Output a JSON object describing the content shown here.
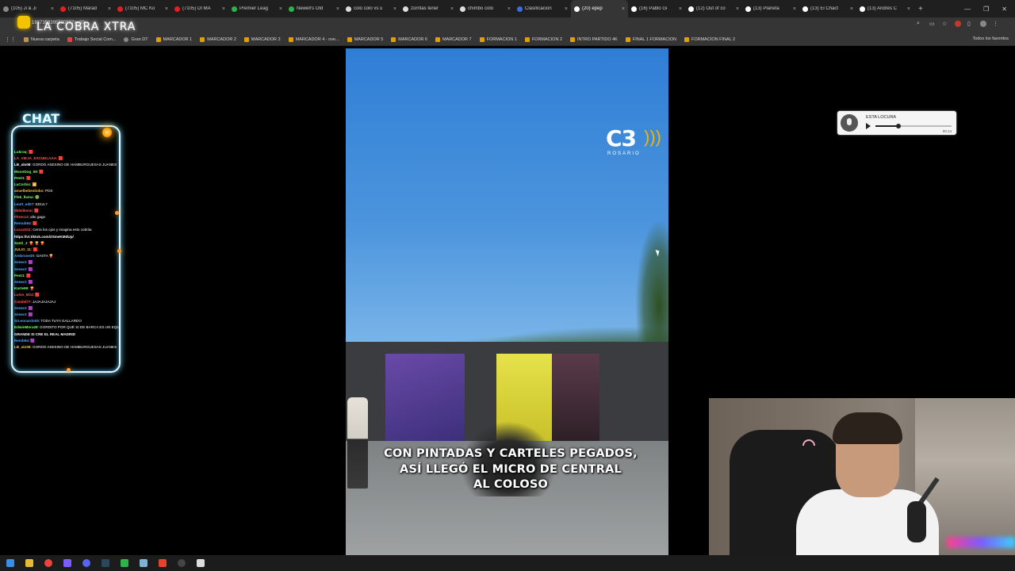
{
  "browser": {
    "tabs": [
      {
        "title": "(105) Ji & Ji",
        "color": "#888888",
        "active": false
      },
      {
        "title": "(7105) Marad",
        "color": "#e02020",
        "active": false
      },
      {
        "title": "(7105) MC Ko",
        "color": "#e02020",
        "active": false
      },
      {
        "title": "(7105) DI MA",
        "color": "#e02020",
        "active": false
      },
      {
        "title": "Premier Leag",
        "color": "#2db34a",
        "active": false
      },
      {
        "title": "Newell's Old",
        "color": "#2db34a",
        "active": false
      },
      {
        "title": "colo colo vs u",
        "color": "#dddddd",
        "active": false
      },
      {
        "title": "zorritas terier",
        "color": "#dddddd",
        "active": false
      },
      {
        "title": "chimbo colo",
        "color": "#dddddd",
        "active": false
      },
      {
        "title": "Clasificación",
        "color": "#3b6ee0",
        "active": false
      },
      {
        "title": "(20) epep",
        "color": "#ffffff",
        "active": true
      },
      {
        "title": "(16) Pablo Gi",
        "color": "#ffffff",
        "active": false
      },
      {
        "title": "(12) Out of co",
        "color": "#ffffff",
        "active": false
      },
      {
        "title": "(13) Planeta",
        "color": "#ffffff",
        "active": false
      },
      {
        "title": "(13) El Chact",
        "color": "#ffffff",
        "active": false
      },
      {
        "title": "(13) Andrés C",
        "color": "#ffffff",
        "active": false
      }
    ],
    "new_tab_glyph": "+",
    "close_glyph": "×",
    "window_controls": [
      "—",
      "❐",
      "✕"
    ],
    "url_fragment": "1937353395530507s=20",
    "bookmarks": [
      {
        "label": "Nueva carpeta",
        "kind": "folder"
      },
      {
        "label": "Trabajo Social Com...",
        "kind": "red"
      },
      {
        "label": "Gran DT",
        "kind": "gray"
      },
      {
        "label": "MARCADOR 1",
        "kind": "u"
      },
      {
        "label": "MARCADOR 2",
        "kind": "u"
      },
      {
        "label": "MARCADOR 3",
        "kind": "u"
      },
      {
        "label": "MARCADOR 4 - ove...",
        "kind": "u"
      },
      {
        "label": "MARCADOR 5",
        "kind": "u"
      },
      {
        "label": "MARCADOR 6",
        "kind": "u"
      },
      {
        "label": "MARCADOR 7",
        "kind": "u"
      },
      {
        "label": "FORMACION 1",
        "kind": "u"
      },
      {
        "label": "FORMACION 2",
        "kind": "u"
      },
      {
        "label": "INTRO PARTIDO 4K",
        "kind": "u"
      },
      {
        "label": "FINAL 1 FORMACION",
        "kind": "u"
      },
      {
        "label": "FORMACION FINAL 2",
        "kind": "u"
      }
    ],
    "all_bookmarks": "Todos los favoritos"
  },
  "overlay": {
    "brand_title": "LA COBRA XTRA",
    "chat_title": "CHAT"
  },
  "chat": [
    {
      "user": "Lukroq",
      "msg": ": 🟥",
      "color": "#7dff6b"
    },
    {
      "user": "LA_VIEJA_ESCUELAAA",
      "msg": ": 🟥",
      "color": "#ff5a5a"
    },
    {
      "user": "LB_alo08",
      "msg": ": GORDO ASESINO DE HAMBURGUESAS JUANES",
      "color": "#ffffff"
    },
    {
      "user": "MoonDog_59",
      "msg": ": 🟥",
      "color": "#7dff6b"
    },
    {
      "user": "Pent1",
      "msg": ": 🟥",
      "color": "#7dff6b"
    },
    {
      "user": "LaCorbix",
      "msg": ": 📶",
      "color": "#7dff6b"
    },
    {
      "user": "anuelbebestiobo",
      "msg": ": PDS",
      "color": "#f0c040"
    },
    {
      "user": "Flek_llama",
      "msg": ": 🟢",
      "color": "#7dff6b"
    },
    {
      "user": "Leutt_ed07",
      "msg": ": EDUL?",
      "color": "#54a9ff"
    },
    {
      "user": "0bb0ikeno",
      "msg": ": 🟥",
      "color": "#ff5a5a"
    },
    {
      "user": "Fhrec12",
      "msg": ": alto gago",
      "color": "#ff5a5a"
    },
    {
      "user": "Remub94",
      "msg": ": 🟥",
      "color": "#54a9ff"
    },
    {
      "user": "Lucas911",
      "msg": ": Cerra los ojos y imagina esto cobrita",
      "color": "#ff5a5a"
    },
    {
      "user": "https://vt.tiktok.com/ZSmeKMdUp/",
      "msg": "",
      "color": "#ffffff"
    },
    {
      "user": "Santi_J",
      "msg": ": 🍟 🍟 🍟",
      "color": "#7dff6b"
    },
    {
      "user": "JULIO_11",
      "msg": ": 🟥",
      "color": "#f0c040"
    },
    {
      "user": "Ambrose30",
      "msg": ": GASTA 🍟",
      "color": "#54a9ff"
    },
    {
      "user": "Xenect",
      "msg": ": 🟪",
      "color": "#54a9ff"
    },
    {
      "user": "Xenect",
      "msg": ": 🟪",
      "color": "#54a9ff"
    },
    {
      "user": "Pent1",
      "msg": ": 🟥",
      "color": "#7dff6b"
    },
    {
      "user": "Xenect",
      "msg": ": 🟪",
      "color": "#54a9ff"
    },
    {
      "user": "Korte99",
      "msg": ": 🍟",
      "color": "#7dff6b"
    },
    {
      "user": "Luisn_M14",
      "msg": ": 🟥",
      "color": "#ff5a5a"
    },
    {
      "user": "Candel77",
      "msg": ": JAJAJAJAJAJ",
      "color": "#ff5a5a"
    },
    {
      "user": "Xenect",
      "msg": ": 🟪",
      "color": "#54a9ff"
    },
    {
      "user": "Xenect",
      "msg": ": 🟪",
      "color": "#54a9ff"
    },
    {
      "user": "SrLeonardo05",
      "msg": ": TODA TUYA GALLARDO",
      "color": "#54a9ff"
    },
    {
      "user": "EdwinMora28",
      "msg": ": GORDITO POR QUÉ SI DE BARCA ES UN EQUIPO",
      "color": "#7dff6b"
    },
    {
      "user": "GRANDE SI CRE EL REAL MADRID",
      "msg": "",
      "color": "#ffffff"
    },
    {
      "user": "Remb94",
      "msg": ": 🟪",
      "color": "#54a9ff"
    },
    {
      "user": "LB_alo08",
      "msg": ": GORDO ASESINO DE HAMBURGUESAS JUANES",
      "color": "#f0c040"
    }
  ],
  "video": {
    "logo_main": "C3",
    "logo_waves": ")))",
    "logo_sub": "ROSARIO",
    "caption_lines": [
      "CON PINTADAS Y CARTELES PEGADOS,",
      "ASÍ LLEGÓ EL MICRO DE CENTRAL",
      "AL COLOSO"
    ]
  },
  "audio": {
    "title": "ESTA LOCURA",
    "time": "00:14",
    "progress": 0.3
  }
}
